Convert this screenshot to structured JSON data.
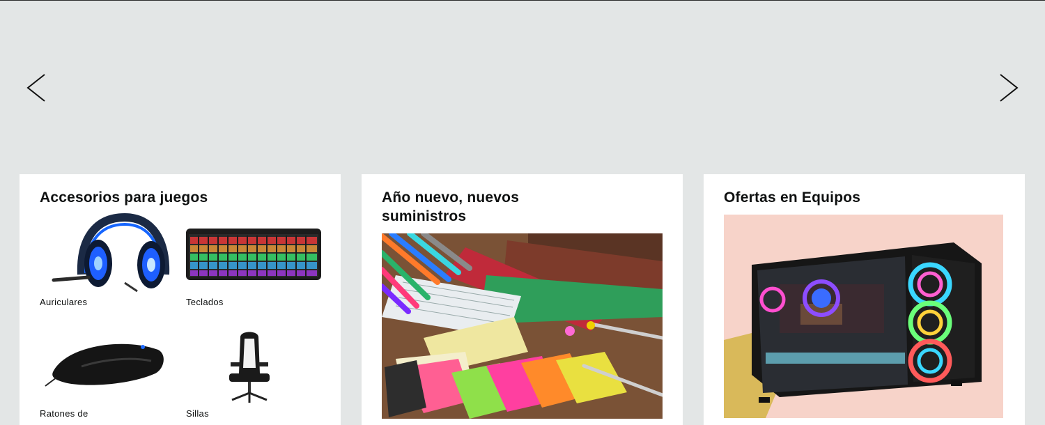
{
  "carousel": {
    "prev_icon": "chevron-left-icon",
    "next_icon": "chevron-right-icon"
  },
  "cards": [
    {
      "title": "Accesorios para juegos",
      "items": [
        {
          "label": "Auriculares",
          "icon": "gaming-headset-image"
        },
        {
          "label": "Teclados",
          "icon": "keyboard-image"
        },
        {
          "label": "Ratones de",
          "icon": "gaming-mouse-image"
        },
        {
          "label": "Sillas",
          "icon": "gaming-chair-image"
        }
      ]
    },
    {
      "title_line1": "Año nuevo, nuevos",
      "title_line2": "suministros",
      "image": "office-supplies-image"
    },
    {
      "title": "Ofertas en Equipos",
      "image": "gaming-pc-case-image"
    }
  ],
  "colors": {
    "page_bg": "#e3e6e6",
    "card_bg": "#ffffff",
    "text": "#0f1111"
  }
}
